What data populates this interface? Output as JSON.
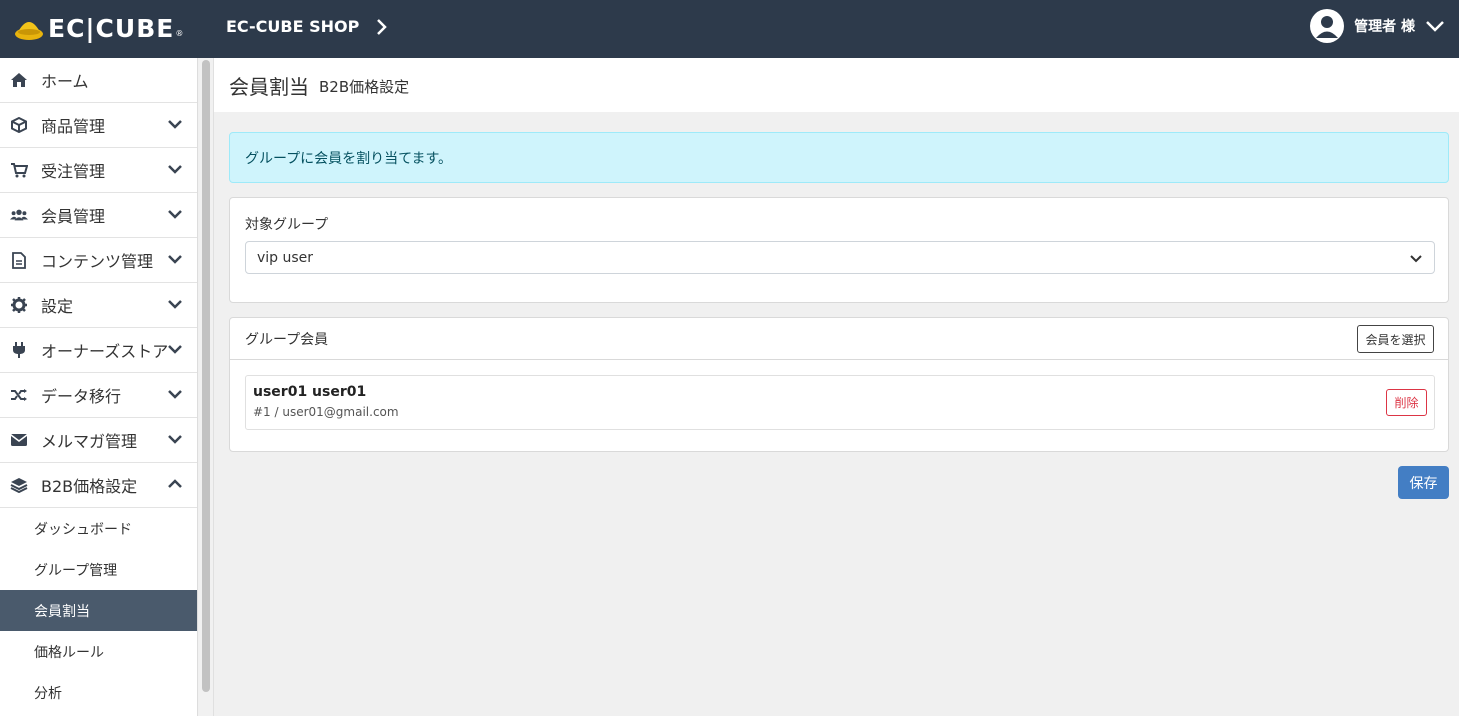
{
  "header": {
    "logo_text": "EC|CUBE",
    "shop_name": "EC-CUBE SHOP",
    "user_name": "管理者 様"
  },
  "sidebar": {
    "items": [
      {
        "label": "ホーム",
        "icon": "home-icon"
      },
      {
        "label": "商品管理",
        "icon": "box-icon"
      },
      {
        "label": "受注管理",
        "icon": "cart-icon"
      },
      {
        "label": "会員管理",
        "icon": "users-icon"
      },
      {
        "label": "コンテンツ管理",
        "icon": "file-icon"
      },
      {
        "label": "設定",
        "icon": "gear-icon"
      },
      {
        "label": "オーナーズストア",
        "icon": "plug-icon"
      },
      {
        "label": "データ移行",
        "icon": "shuffle-icon"
      },
      {
        "label": "メルマガ管理",
        "icon": "envelope-icon"
      },
      {
        "label": "B2B価格設定",
        "icon": "layers-icon"
      }
    ],
    "subitems": [
      {
        "label": "ダッシュボード"
      },
      {
        "label": "グループ管理"
      },
      {
        "label": "会員割当",
        "active": true
      },
      {
        "label": "価格ルール"
      },
      {
        "label": "分析"
      }
    ]
  },
  "page": {
    "title": "会員割当",
    "subtitle": "B2B価格設定",
    "alert": "グループに会員を割り当てます。"
  },
  "target_group": {
    "label": "対象グループ",
    "selected": "vip user"
  },
  "group_members": {
    "title": "グループ会員",
    "select_button": "会員を選択",
    "members": [
      {
        "name": "user01 user01",
        "detail": "#1 / user01@gmail.com",
        "delete_label": "削除"
      }
    ]
  },
  "actions": {
    "save_label": "保存"
  },
  "colors": {
    "header_bg": "#2d3a4b",
    "active_nav_bg": "#4a5a6c",
    "primary": "#437ec4",
    "danger": "#dc3545",
    "alert_bg": "#cff4fc"
  }
}
